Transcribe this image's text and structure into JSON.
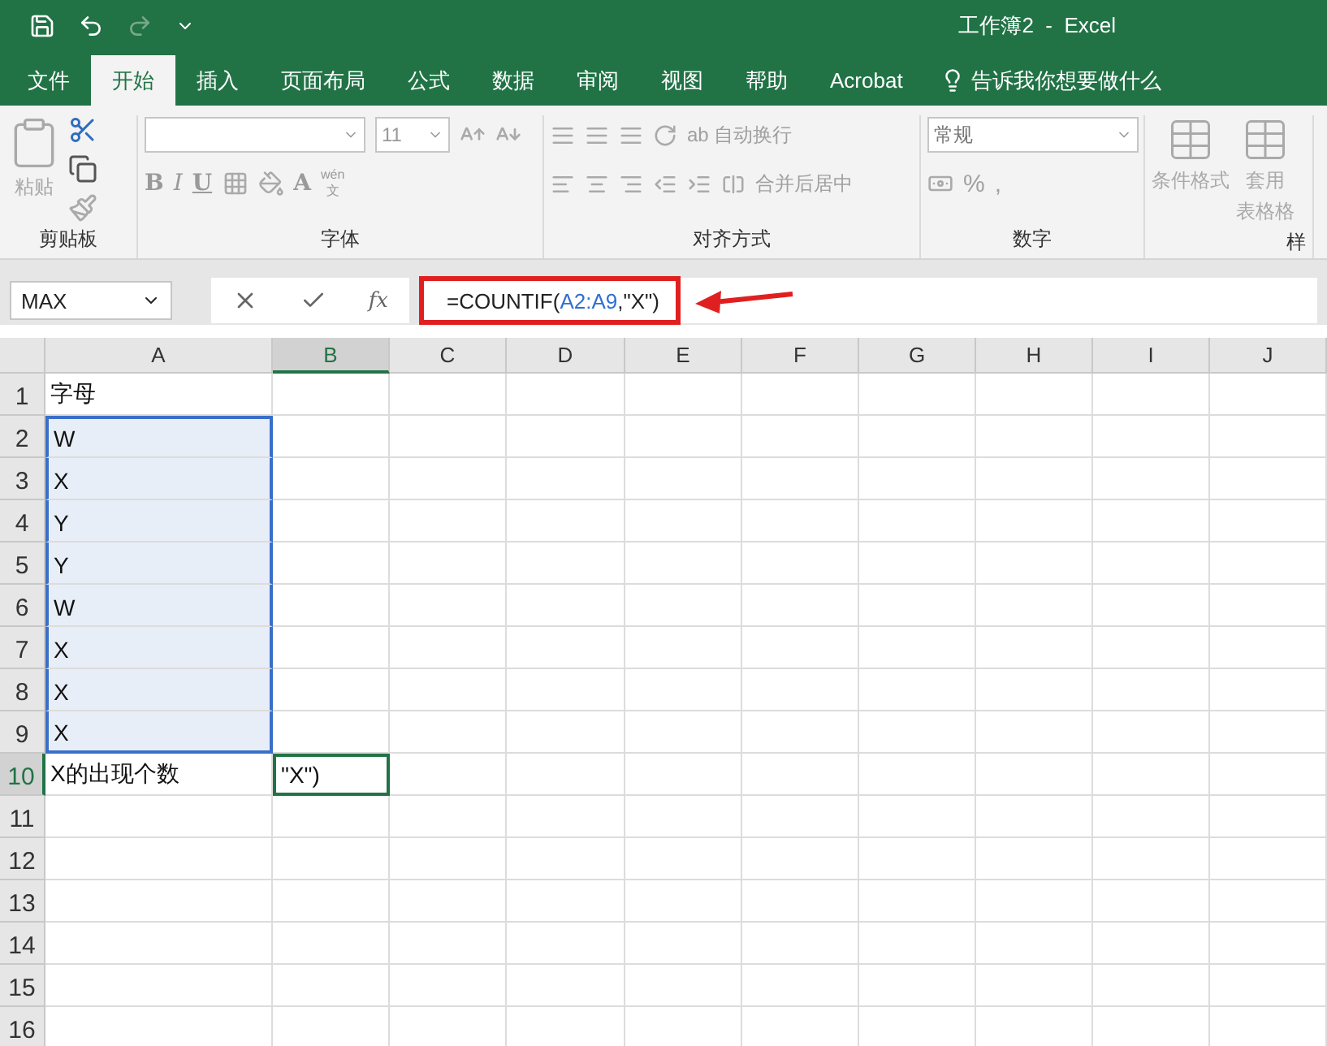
{
  "title": "工作簿2  -  Excel",
  "tabs": [
    {
      "label": "文件",
      "selected": false
    },
    {
      "label": "开始",
      "selected": true
    },
    {
      "label": "插入",
      "selected": false
    },
    {
      "label": "页面布局",
      "selected": false
    },
    {
      "label": "公式",
      "selected": false
    },
    {
      "label": "数据",
      "selected": false
    },
    {
      "label": "审阅",
      "selected": false
    },
    {
      "label": "视图",
      "selected": false
    },
    {
      "label": "帮助",
      "selected": false
    },
    {
      "label": "Acrobat",
      "selected": false
    }
  ],
  "tell_me": "告诉我你想要做什么",
  "ribbon": {
    "clipboard": {
      "label": "剪贴板",
      "paste": "粘贴"
    },
    "font": {
      "label": "字体",
      "size": "11",
      "bold": "B",
      "italic": "I",
      "underline": "U",
      "font_color": "A",
      "phonetic_top": "wén",
      "phonetic_bottom": "文"
    },
    "alignment": {
      "label": "对齐方式",
      "wrap": "自动换行",
      "wrap_icon_top": "ab",
      "merge": "合并后居中"
    },
    "number": {
      "label": "数字",
      "format": "常规",
      "percent": "%",
      "comma": ","
    },
    "styles": {
      "label": "样",
      "conditional": "条件格式",
      "table_top": "套用",
      "table_bottom": "表格格"
    }
  },
  "formula_bar": {
    "name_box": "MAX",
    "fx": "fx",
    "formula_start": "=COUNTIF(",
    "formula_ref": "A2:A9",
    "formula_end": ",\"X\")",
    "highlighted": true
  },
  "columns": [
    {
      "label": "A",
      "selected": false
    },
    {
      "label": "B",
      "selected": true
    },
    {
      "label": "C",
      "selected": false
    },
    {
      "label": "D",
      "selected": false
    },
    {
      "label": "E",
      "selected": false
    },
    {
      "label": "F",
      "selected": false
    },
    {
      "label": "G",
      "selected": false
    },
    {
      "label": "H",
      "selected": false
    },
    {
      "label": "I",
      "selected": false
    },
    {
      "label": "J",
      "selected": false
    }
  ],
  "rows": [
    {
      "number": "1",
      "selected": false,
      "a": "字母",
      "a_in_range": false
    },
    {
      "number": "2",
      "selected": false,
      "a": "W",
      "a_in_range": true
    },
    {
      "number": "3",
      "selected": false,
      "a": "X",
      "a_in_range": true
    },
    {
      "number": "4",
      "selected": false,
      "a": "Y",
      "a_in_range": true
    },
    {
      "number": "5",
      "selected": false,
      "a": "Y",
      "a_in_range": true
    },
    {
      "number": "6",
      "selected": false,
      "a": "W",
      "a_in_range": true
    },
    {
      "number": "7",
      "selected": false,
      "a": "X",
      "a_in_range": true
    },
    {
      "number": "8",
      "selected": false,
      "a": "X",
      "a_in_range": true
    },
    {
      "number": "9",
      "selected": false,
      "a": "X",
      "a_in_range": true
    },
    {
      "number": "10",
      "selected": true,
      "a": "X的出现个数",
      "a_in_range": false,
      "b": "\"X\")",
      "b_active": true
    },
    {
      "number": "11",
      "selected": false,
      "a_in_range": false
    },
    {
      "number": "12",
      "selected": false,
      "a_in_range": false
    },
    {
      "number": "13",
      "selected": false,
      "a_in_range": false
    },
    {
      "number": "14",
      "selected": false,
      "a_in_range": false
    },
    {
      "number": "15",
      "selected": false,
      "a_in_range": false
    },
    {
      "number": "16",
      "selected": false,
      "a_in_range": false
    }
  ]
}
